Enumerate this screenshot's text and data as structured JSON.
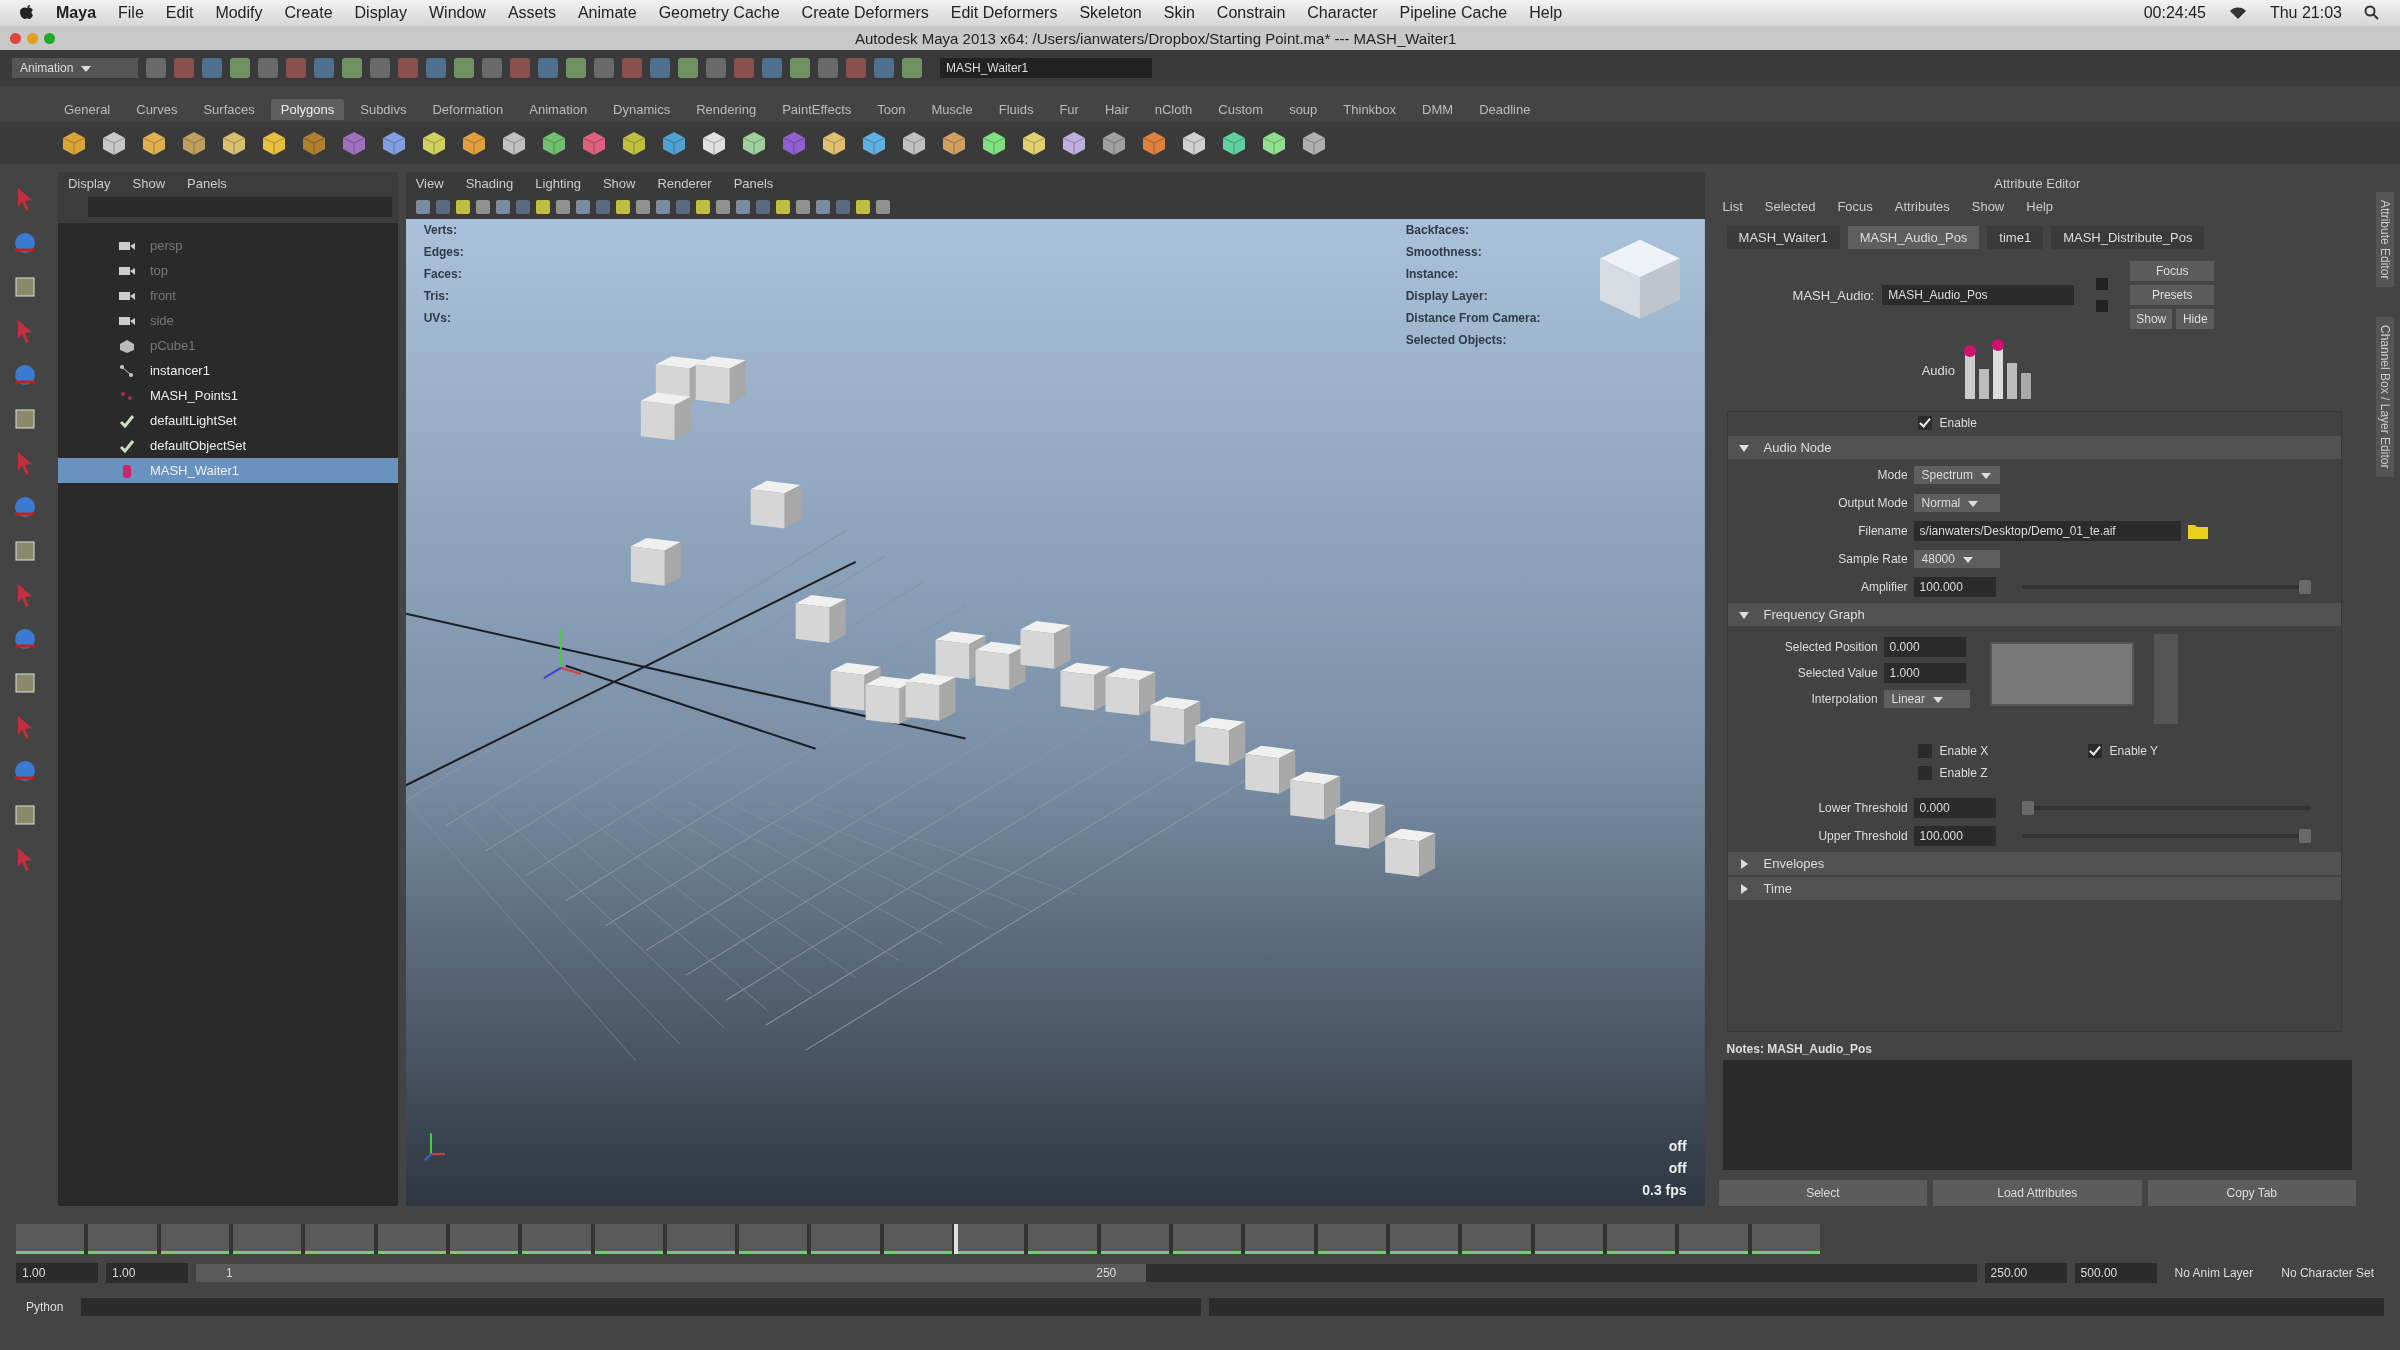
{
  "mac_menu": {
    "items": [
      "Maya",
      "File",
      "Edit",
      "Modify",
      "Create",
      "Display",
      "Window",
      "Assets",
      "Animate",
      "Geometry Cache",
      "Create Deformers",
      "Edit Deformers",
      "Skeleton",
      "Skin",
      "Constrain",
      "Character",
      "Pipeline Cache",
      "Help"
    ],
    "clock": "00:24:45",
    "time": "Thu 21:03"
  },
  "window": {
    "title": "Autodesk Maya 2013 x64: /Users/ianwaters/Dropbox/Starting Point.ma* --- MASH_Waiter1"
  },
  "status_line": {
    "menu_set": "Animation",
    "name_field": "MASH_Waiter1"
  },
  "shelf_tabs": [
    {
      "label": "General",
      "selected": false
    },
    {
      "label": "Curves",
      "selected": false
    },
    {
      "label": "Surfaces",
      "selected": false
    },
    {
      "label": "Polygons",
      "selected": true
    },
    {
      "label": "Subdivs",
      "selected": false
    },
    {
      "label": "Deformation",
      "selected": false
    },
    {
      "label": "Animation",
      "selected": false
    },
    {
      "label": "Dynamics",
      "selected": false
    },
    {
      "label": "Rendering",
      "selected": false
    },
    {
      "label": "PaintEffects",
      "selected": false
    },
    {
      "label": "Toon",
      "selected": false
    },
    {
      "label": "Muscle",
      "selected": false
    },
    {
      "label": "Fluids",
      "selected": false
    },
    {
      "label": "Fur",
      "selected": false
    },
    {
      "label": "Hair",
      "selected": false
    },
    {
      "label": "nCloth",
      "selected": false
    },
    {
      "label": "Custom",
      "selected": false
    },
    {
      "label": "soup",
      "selected": false
    },
    {
      "label": "Thinkbox",
      "selected": false
    },
    {
      "label": "DMM",
      "selected": false
    },
    {
      "label": "Deadline",
      "selected": false
    }
  ],
  "outliner": {
    "menu": [
      "Display",
      "Show",
      "Panels"
    ],
    "items": [
      {
        "label": "persp",
        "kind": "camera",
        "dimmed": true,
        "selected": false
      },
      {
        "label": "top",
        "kind": "camera",
        "dimmed": true,
        "selected": false
      },
      {
        "label": "front",
        "kind": "camera",
        "dimmed": true,
        "selected": false
      },
      {
        "label": "side",
        "kind": "camera",
        "dimmed": true,
        "selected": false
      },
      {
        "label": "pCube1",
        "kind": "mesh",
        "dimmed": true,
        "selected": false
      },
      {
        "label": "instancer1",
        "kind": "instancer",
        "dimmed": false,
        "selected": false
      },
      {
        "label": "MASH_Points1",
        "kind": "points",
        "dimmed": false,
        "selected": false
      },
      {
        "label": "defaultLightSet",
        "kind": "set",
        "dimmed": false,
        "selected": false
      },
      {
        "label": "defaultObjectSet",
        "kind": "set",
        "dimmed": false,
        "selected": false
      },
      {
        "label": "MASH_Waiter1",
        "kind": "mash",
        "dimmed": false,
        "selected": true
      }
    ]
  },
  "viewport": {
    "menu": [
      "View",
      "Shading",
      "Lighting",
      "Show",
      "Renderer",
      "Panels"
    ],
    "hud_left": [
      "Verts:",
      "Edges:",
      "Faces:",
      "Tris:",
      "UVs:"
    ],
    "hud_right": [
      "Backfaces:",
      "Smoothness:",
      "Instance:",
      "Display Layer:",
      "Distance From Camera:",
      "Selected Objects:"
    ],
    "status": [
      "off",
      "off",
      "0.3 fps"
    ]
  },
  "attribute_editor": {
    "title": "Attribute Editor",
    "menu": [
      "List",
      "Selected",
      "Focus",
      "Attributes",
      "Show",
      "Help"
    ],
    "tabs": [
      {
        "label": "MASH_Waiter1",
        "selected": false
      },
      {
        "label": "MASH_Audio_Pos",
        "selected": true
      },
      {
        "label": "time1",
        "selected": false
      },
      {
        "label": "MASH_Distribute_Pos",
        "selected": false
      }
    ],
    "node_label": "MASH_Audio:",
    "node_name": "MASH_Audio_Pos",
    "node_buttons": [
      "Focus",
      "Presets",
      "Show",
      "Hide"
    ],
    "icon_label": "Audio",
    "enable": {
      "label": "Enable",
      "checked": true
    },
    "sections": [
      {
        "title": "Audio Node",
        "expanded": true,
        "rows": [
          {
            "kind": "dropdown",
            "label": "Mode",
            "value": "Spectrum"
          },
          {
            "kind": "dropdown",
            "label": "Output Mode",
            "value": "Normal"
          },
          {
            "kind": "file",
            "label": "Filename",
            "value": "s/ianwaters/Desktop/Demo_01_te.aif"
          },
          {
            "kind": "dropdown",
            "label": "Sample Rate",
            "value": "48000"
          },
          {
            "kind": "slider",
            "label": "Amplifier",
            "value": "100.000",
            "level": 1.0
          }
        ]
      },
      {
        "title": "Frequency Graph",
        "expanded": true,
        "rows": [
          {
            "kind": "graph",
            "fields": [
              {
                "label": "Selected Position",
                "value": "0.000"
              },
              {
                "label": "Selected Value",
                "value": "1.000"
              }
            ],
            "interpolation_label": "Interpolation",
            "interpolation": "Linear"
          },
          {
            "kind": "checks",
            "items": [
              {
                "label": "Enable X",
                "checked": false
              },
              {
                "label": "Enable Y",
                "checked": true
              },
              {
                "label": "Enable Z",
                "checked": false
              }
            ]
          },
          {
            "kind": "slider",
            "label": "Lower Threshold",
            "value": "0.000",
            "level": 0.0
          },
          {
            "kind": "slider",
            "label": "Upper Threshold",
            "value": "100.000",
            "level": 1.0
          }
        ]
      },
      {
        "title": "Envelopes",
        "expanded": false
      },
      {
        "title": "Time",
        "expanded": false
      }
    ],
    "notes": "Notes:  MASH_Audio_Pos",
    "buttons": [
      "Select",
      "Load Attributes",
      "Copy Tab"
    ]
  },
  "side_tabs": [
    "Attribute Editor",
    "Channel Box / Layer Editor"
  ],
  "time_slider": {
    "level": 0.52
  },
  "range": {
    "level": 0.5,
    "start": "1.00",
    "playback_start": "1.00",
    "slider_start": "1",
    "slider_end": "250",
    "playback_end": "250.00",
    "end": "500.00",
    "anim_layer": "No Anim Layer",
    "character_set": "No Character Set"
  },
  "command_line": {
    "label": "Python"
  }
}
